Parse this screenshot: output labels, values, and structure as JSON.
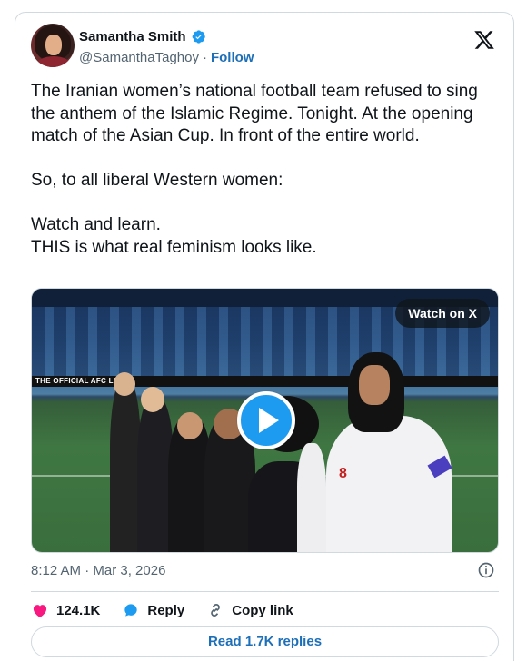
{
  "author": {
    "name": "Samantha Smith",
    "handle": "@SamanthaTaghoy",
    "follow_label": "Follow",
    "verified": true
  },
  "tweet": {
    "text": "The Iranian women’s national football team refused to sing the anthem of the Islamic Regime. Tonight. At the opening match of the Asian Cup. In front of the entire world.\n\nSo, to all liberal Western women:\n\nWatch and learn.\nTHIS is what real feminism looks like.",
    "timestamp": "8:12 AM · Mar 3, 2026"
  },
  "media": {
    "type": "video",
    "watch_label": "Watch on X",
    "adboard_text": "THE OFFICIAL AFC LIVE",
    "jersey_number": "8"
  },
  "actions": {
    "likes": "124.1K",
    "reply_label": "Reply",
    "copy_link_label": "Copy link"
  },
  "replies_button": "Read 1.7K replies",
  "colors": {
    "accent": "#1d9bf0",
    "link": "#1d6fb8",
    "like": "#f91880",
    "text_secondary": "#536471"
  },
  "icons": [
    "verified-badge-icon",
    "x-logo-icon",
    "play-icon",
    "info-icon",
    "heart-icon",
    "reply-icon",
    "link-icon"
  ]
}
